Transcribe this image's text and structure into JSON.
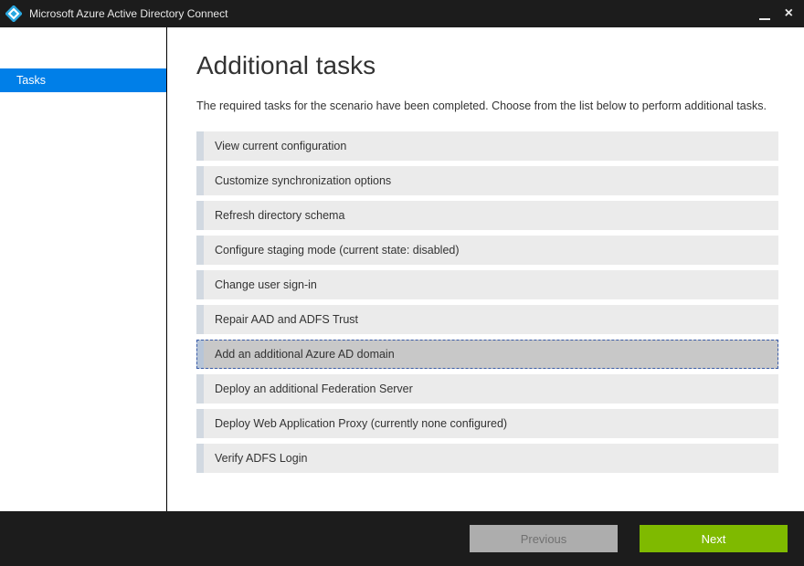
{
  "titlebar": {
    "title": "Microsoft Azure Active Directory Connect"
  },
  "sidebar": {
    "items": [
      {
        "label": "Tasks",
        "active": true
      }
    ]
  },
  "main": {
    "heading": "Additional tasks",
    "description": "The required tasks for the scenario have been completed. Choose from the list below to perform additional tasks.",
    "tasks": [
      {
        "label": "View current configuration"
      },
      {
        "label": "Customize synchronization options"
      },
      {
        "label": "Refresh directory schema"
      },
      {
        "label": "Configure staging mode (current state: disabled)"
      },
      {
        "label": "Change user sign-in"
      },
      {
        "label": "Repair AAD and ADFS Trust"
      },
      {
        "label": "Add an additional Azure AD domain",
        "selected": true
      },
      {
        "label": "Deploy an additional Federation Server"
      },
      {
        "label": "Deploy Web Application Proxy (currently none configured)"
      },
      {
        "label": "Verify ADFS Login"
      }
    ]
  },
  "footer": {
    "previous_label": "Previous",
    "next_label": "Next"
  }
}
